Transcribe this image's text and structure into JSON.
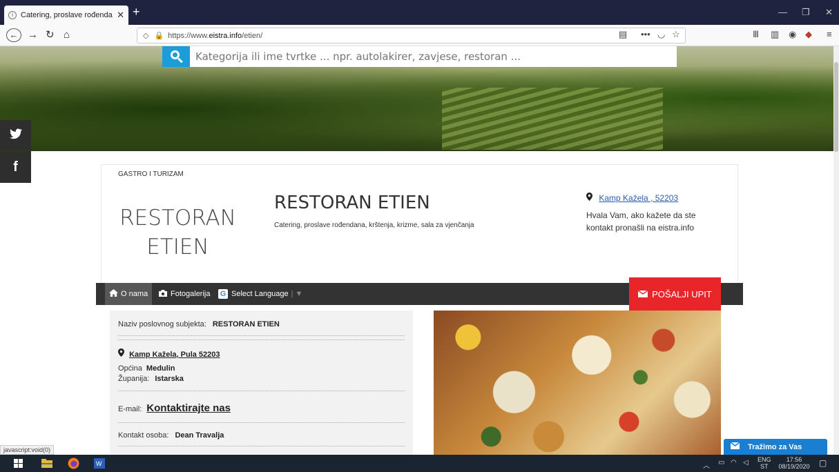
{
  "browser": {
    "tab_title": "Catering, proslave rođendana, k",
    "tab_close": "✕",
    "new_tab": "+",
    "url_prefix": "https://www.",
    "url_domain": "eistra.info",
    "url_path": "/etien/",
    "status_text": "javascript:void(0)"
  },
  "search": {
    "placeholder": "Kategorija ili ime tvrtke ... npr. autolakirer, zavjese, restoran ..."
  },
  "social": {
    "twitter": "🐦",
    "facebook": "f"
  },
  "business": {
    "category": "GASTRO I TURIZAM",
    "logo_line1": "RESTORAN",
    "logo_line2": "ETIEN",
    "name": "RESTORAN ETIEN",
    "description": "Catering, proslave rođendana, krštenja, krizme, sala za vjenčanja",
    "address_short": "Kamp Kažela , 52203",
    "thanks_note": "Hvala Vam, ako kažete da ste kontakt pronašli na eistra.info"
  },
  "menu": {
    "about": "O nama",
    "gallery": "Fotogalerija",
    "language": "Select Language",
    "send_inquiry": "POŠALJI UPIT"
  },
  "info": {
    "subject_label": "Naziv poslovnog subjekta:",
    "subject_value": "RESTORAN ETIEN",
    "address": "Kamp Kažela, Pula 52203",
    "municipality_label": "Općina",
    "municipality_value": "Medulin",
    "county_label": "Županija:",
    "county_value": "Istarska",
    "email_label": "E-mail:",
    "email_link": "Kontaktirajte nas",
    "contact_label": "Kontakt osoba:",
    "contact_value": "Dean Travalja"
  },
  "chat": {
    "label": "Tražimo za Vas"
  },
  "taskbar": {
    "lang": "ENG",
    "lang2": "ST",
    "time": "17:56",
    "date": "08/19/2020"
  },
  "colors": {
    "accent_blue": "#1a9dd9",
    "inquiry_red": "#e8262a",
    "menu_dark": "#333333",
    "chat_blue": "#1a7fd1"
  }
}
